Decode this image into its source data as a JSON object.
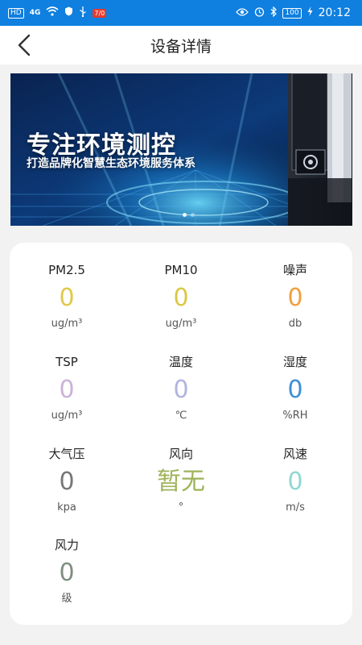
{
  "status_bar": {
    "left_icons": [
      "HD",
      "4G",
      "wifi-icon",
      "shield-icon",
      "usb-icon",
      "badge"
    ],
    "left_hd": "HD",
    "left_4g": "4G",
    "left_badge": "7/0",
    "battery": "100",
    "time": "20:12"
  },
  "nav": {
    "back_icon": "chevron-left-icon",
    "title": "设备详情"
  },
  "banner": {
    "title": "专注环境测控",
    "subtitle": "打造品牌化智慧生态环境服务体系",
    "slides": 2,
    "active_slide": 1
  },
  "metrics": [
    {
      "label": "PM2.5",
      "value": "0",
      "unit": "ug/m³",
      "color": "#e0c94a"
    },
    {
      "label": "PM10",
      "value": "0",
      "unit": "ug/m³",
      "color": "#d9c845"
    },
    {
      "label": "噪声",
      "value": "0",
      "unit": "db",
      "color": "#f0a03c"
    },
    {
      "label": "TSP",
      "value": "0",
      "unit": "ug/m³",
      "color": "#cbb2d9"
    },
    {
      "label": "温度",
      "value": "0",
      "unit": "℃",
      "color": "#b1b3e0"
    },
    {
      "label": "湿度",
      "value": "0",
      "unit": "%RH",
      "color": "#3e8fd6"
    },
    {
      "label": "大气压",
      "value": "0",
      "unit": "kpa",
      "color": "#777777"
    },
    {
      "label": "风向",
      "value": "暂无",
      "unit": "°",
      "color": "#9eb35a"
    },
    {
      "label": "风速",
      "value": "0",
      "unit": "m/s",
      "color": "#8fd8d3"
    },
    {
      "label": "风力",
      "value": "0",
      "unit": "级",
      "color": "#7f8f80"
    }
  ]
}
